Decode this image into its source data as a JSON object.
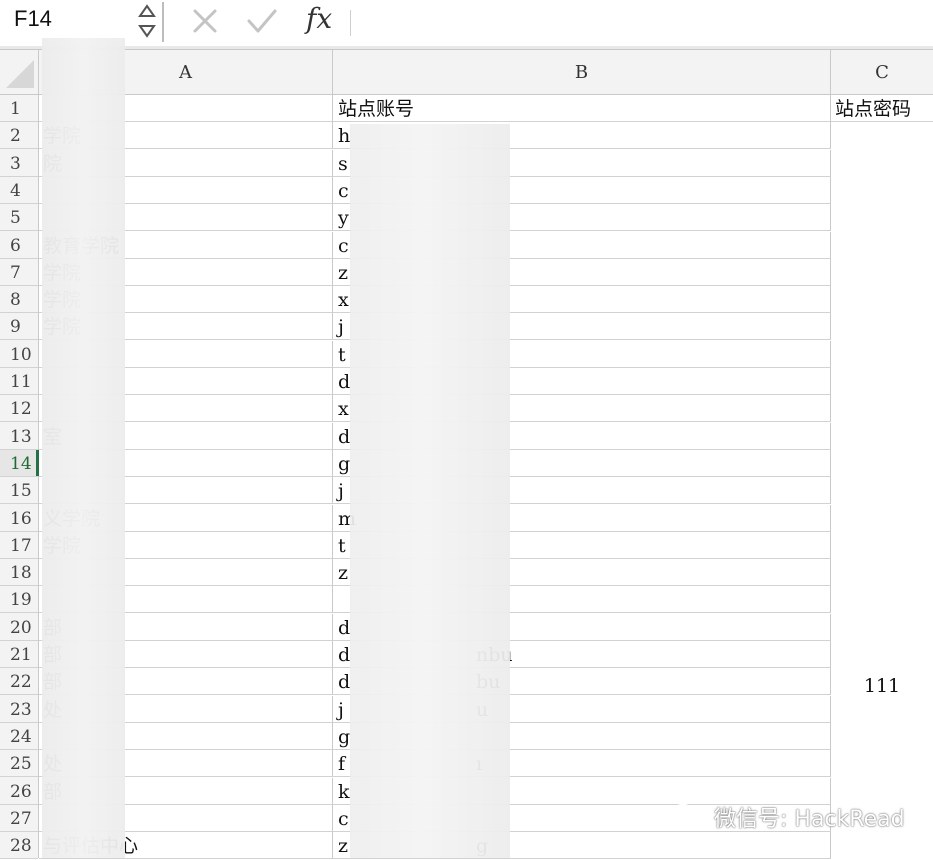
{
  "formula_bar": {
    "name_box": "F14",
    "cancel_icon": "x-icon",
    "confirm_icon": "check-icon",
    "fx_label": "fx",
    "formula_value": ""
  },
  "columns": [
    "A",
    "B",
    "C"
  ],
  "rows": [
    {
      "n": "1",
      "a": "",
      "b": "站点账号",
      "b_tail": "",
      "c": "站点密码"
    },
    {
      "n": "2",
      "a": "学院",
      "b": "h",
      "b_tail": "",
      "c": ""
    },
    {
      "n": "3",
      "a": "院",
      "b": "s",
      "b_tail": "",
      "c": ""
    },
    {
      "n": "4",
      "a": "",
      "b": "c",
      "b_tail": "",
      "c": ""
    },
    {
      "n": "5",
      "a": "",
      "b": "y",
      "b_tail": "",
      "c": ""
    },
    {
      "n": "6",
      "a": "教育学院",
      "b": "c",
      "b_tail": "",
      "c": ""
    },
    {
      "n": "7",
      "a": "学院",
      "b": "z",
      "b_tail": "",
      "c": ""
    },
    {
      "n": "8",
      "a": "学院",
      "b": "x",
      "b_tail": "",
      "c": ""
    },
    {
      "n": "9",
      "a": "学院",
      "b": "j",
      "b_tail": "",
      "c": ""
    },
    {
      "n": "10",
      "a": "",
      "b": "t",
      "b_tail": "",
      "c": ""
    },
    {
      "n": "11",
      "a": "",
      "b": "d",
      "b_tail": "",
      "c": ""
    },
    {
      "n": "12",
      "a": "",
      "b": "x",
      "b_tail": "",
      "c": ""
    },
    {
      "n": "13",
      "a": "室",
      "b": "d",
      "b_tail": "",
      "c": ""
    },
    {
      "n": "14",
      "a": "",
      "b": "g",
      "b_tail": "",
      "c": ""
    },
    {
      "n": "15",
      "a": "",
      "b": "j",
      "b_tail": "",
      "c": ""
    },
    {
      "n": "16",
      "a": "义学院",
      "b": "m",
      "b_tail": "",
      "c": ""
    },
    {
      "n": "17",
      "a": "学院",
      "b": "t",
      "b_tail": "",
      "c": ""
    },
    {
      "n": "18",
      "a": "",
      "b": "z",
      "b_tail": "",
      "c": ""
    },
    {
      "n": "19",
      "a": "",
      "b": "",
      "b_tail": "",
      "c": ""
    },
    {
      "n": "20",
      "a": "部",
      "b": "d",
      "b_tail": "",
      "c": ""
    },
    {
      "n": "21",
      "a": "部",
      "b": "d",
      "b_tail": "nbu",
      "c": ""
    },
    {
      "n": "22",
      "a": "部",
      "b": "d",
      "b_tail": "bu",
      "c": ""
    },
    {
      "n": "23",
      "a": "处",
      "b": "j",
      "b_tail": "u",
      "c": ""
    },
    {
      "n": "24",
      "a": "",
      "b": "g",
      "b_tail": "",
      "c": ""
    },
    {
      "n": "25",
      "a": "处",
      "b": "f",
      "b_tail": "ı",
      "c": ""
    },
    {
      "n": "26",
      "a": "部",
      "b": "k",
      "b_tail": "",
      "c": ""
    },
    {
      "n": "27",
      "a": "",
      "b": "c",
      "b_tail": "",
      "c": ""
    },
    {
      "n": "28",
      "a": "与评估中心",
      "b": "z",
      "b_tail": "g",
      "c": ""
    }
  ],
  "merged_c_value": "111",
  "selected_row": "14",
  "watermark": {
    "icon": "wechat-icon",
    "text": "微信号: HackRead"
  },
  "colors": {
    "selection_accent": "#217346",
    "header_bg": "#f3f3f3",
    "gridline": "#d2d2d2"
  }
}
